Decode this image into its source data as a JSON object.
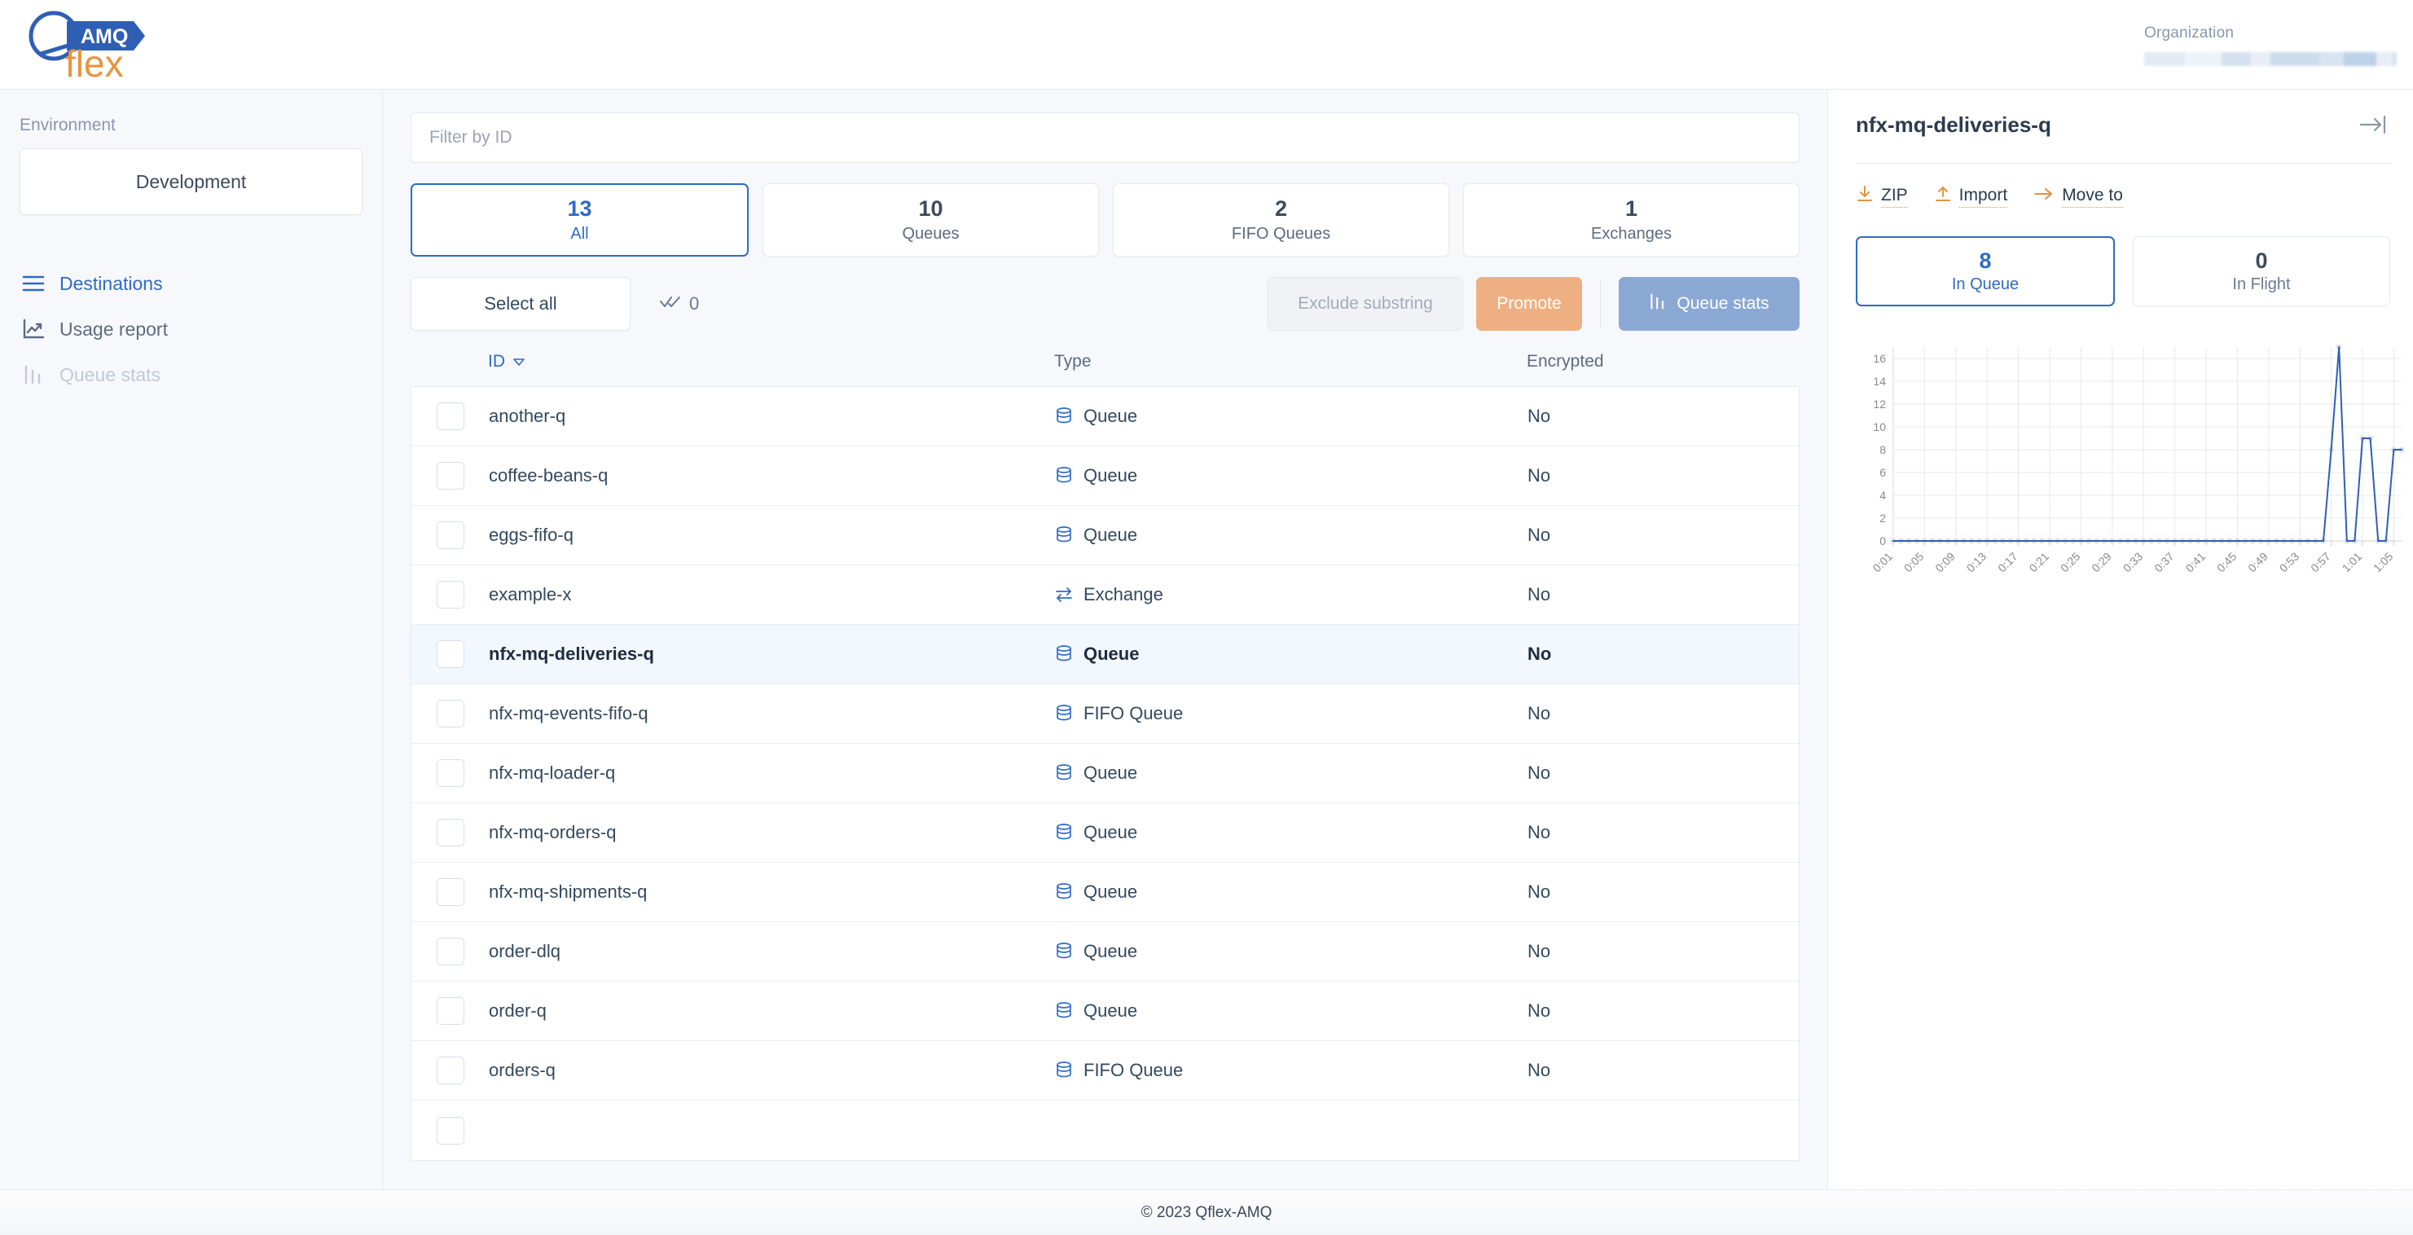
{
  "brand": {
    "name_top": "AMQ",
    "name_bottom": "flex"
  },
  "header": {
    "org_label": "Organization"
  },
  "sidebar": {
    "env_label": "Environment",
    "env_value": "Development",
    "items": [
      {
        "label": "Destinations",
        "icon": "menu-lines-icon",
        "state": "active"
      },
      {
        "label": "Usage report",
        "icon": "trend-chart-icon",
        "state": "normal"
      },
      {
        "label": "Queue stats",
        "icon": "bar-chart-icon",
        "state": "disabled"
      }
    ]
  },
  "main": {
    "filter_placeholder": "Filter by ID",
    "filter_value": "",
    "stat_cards": [
      {
        "num": "13",
        "label": "All",
        "selected": true
      },
      {
        "num": "10",
        "label": "Queues",
        "selected": false
      },
      {
        "num": "2",
        "label": "FIFO Queues",
        "selected": false
      },
      {
        "num": "1",
        "label": "Exchanges",
        "selected": false
      }
    ],
    "toolbar": {
      "select_all_label": "Select all",
      "selected_count": "0",
      "exclude_label": "Exclude substring",
      "promote_label": "Promote",
      "queue_stats_label": "Queue stats"
    },
    "table": {
      "columns": [
        "ID",
        "Type",
        "Encrypted"
      ],
      "sort_column": "ID",
      "sort_dir": "desc",
      "rows": [
        {
          "id": "another-q",
          "type": "Queue",
          "type_icon": "database-stack-icon",
          "encrypted": "No",
          "checked": false,
          "selected": false
        },
        {
          "id": "coffee-beans-q",
          "type": "Queue",
          "type_icon": "database-stack-icon",
          "encrypted": "No",
          "checked": false,
          "selected": false
        },
        {
          "id": "eggs-fifo-q",
          "type": "Queue",
          "type_icon": "database-stack-icon",
          "encrypted": "No",
          "checked": false,
          "selected": false
        },
        {
          "id": "example-x",
          "type": "Exchange",
          "type_icon": "swap-arrows-icon",
          "encrypted": "No",
          "checked": false,
          "selected": false
        },
        {
          "id": "nfx-mq-deliveries-q",
          "type": "Queue",
          "type_icon": "database-stack-icon",
          "encrypted": "No",
          "checked": false,
          "selected": true
        },
        {
          "id": "nfx-mq-events-fifo-q",
          "type": "FIFO Queue",
          "type_icon": "database-stack-icon",
          "encrypted": "No",
          "checked": false,
          "selected": false
        },
        {
          "id": "nfx-mq-loader-q",
          "type": "Queue",
          "type_icon": "database-stack-icon",
          "encrypted": "No",
          "checked": false,
          "selected": false
        },
        {
          "id": "nfx-mq-orders-q",
          "type": "Queue",
          "type_icon": "database-stack-icon",
          "encrypted": "No",
          "checked": false,
          "selected": false
        },
        {
          "id": "nfx-mq-shipments-q",
          "type": "Queue",
          "type_icon": "database-stack-icon",
          "encrypted": "No",
          "checked": false,
          "selected": false
        },
        {
          "id": "order-dlq",
          "type": "Queue",
          "type_icon": "database-stack-icon",
          "encrypted": "No",
          "checked": false,
          "selected": false
        },
        {
          "id": "order-q",
          "type": "Queue",
          "type_icon": "database-stack-icon",
          "encrypted": "No",
          "checked": false,
          "selected": false
        },
        {
          "id": "orders-q",
          "type": "FIFO Queue",
          "type_icon": "database-stack-icon",
          "encrypted": "No",
          "checked": false,
          "selected": false
        }
      ]
    }
  },
  "detail": {
    "title": "nfx-mq-deliveries-q",
    "collapse_icon": "collapse-right-icon",
    "actions": [
      {
        "label": "ZIP",
        "icon": "download-icon"
      },
      {
        "label": "Import",
        "icon": "upload-icon"
      },
      {
        "label": "Move to",
        "icon": "arrow-right-icon"
      }
    ],
    "counters": [
      {
        "num": "8",
        "label": "In Queue",
        "selected": true
      },
      {
        "num": "0",
        "label": "In Flight",
        "selected": false
      }
    ]
  },
  "chart_data": {
    "type": "line",
    "title": "",
    "xlabel": "",
    "ylabel": "",
    "ylim": [
      0,
      17
    ],
    "yticks": [
      0,
      2,
      4,
      6,
      8,
      10,
      12,
      14,
      16
    ],
    "grid": true,
    "legend": "none",
    "tick_labels": [
      "0:01",
      "0:05",
      "0:09",
      "0:13",
      "0:17",
      "0:21",
      "0:25",
      "0:29",
      "0:33",
      "0:37",
      "0:41",
      "0:45",
      "0:49",
      "0:53",
      "0:57",
      "1:01",
      "1:05"
    ],
    "series": [
      {
        "name": "In Queue",
        "color": "#2f5fb4",
        "values": [
          0,
          0,
          0,
          0,
          0,
          0,
          0,
          0,
          0,
          0,
          0,
          0,
          0,
          0,
          0,
          0,
          0,
          0,
          0,
          0,
          0,
          0,
          0,
          0,
          0,
          0,
          0,
          0,
          0,
          0,
          0,
          0,
          0,
          0,
          0,
          0,
          0,
          0,
          0,
          0,
          0,
          0,
          0,
          0,
          0,
          0,
          0,
          0,
          0,
          0,
          0,
          0,
          0,
          0,
          0,
          0,
          8,
          17,
          0,
          0,
          9,
          9,
          0,
          0,
          8,
          8
        ]
      }
    ],
    "x": [
      "0:01",
      "0:02",
      "0:03",
      "0:04",
      "0:05",
      "0:06",
      "0:07",
      "0:08",
      "0:09",
      "0:10",
      "0:11",
      "0:12",
      "0:13",
      "0:14",
      "0:15",
      "0:16",
      "0:17",
      "0:18",
      "0:19",
      "0:20",
      "0:21",
      "0:22",
      "0:23",
      "0:24",
      "0:25",
      "0:26",
      "0:27",
      "0:28",
      "0:29",
      "0:30",
      "0:31",
      "0:32",
      "0:33",
      "0:34",
      "0:35",
      "0:36",
      "0:37",
      "0:38",
      "0:39",
      "0:40",
      "0:41",
      "0:42",
      "0:43",
      "0:44",
      "0:45",
      "0:46",
      "0:47",
      "0:48",
      "0:49",
      "0:50",
      "0:51",
      "0:52",
      "0:53",
      "0:54",
      "0:55",
      "0:56",
      "0:57",
      "0:58",
      "0:59",
      "1:00",
      "1:01",
      "1:02",
      "1:03",
      "1:04",
      "1:05",
      "1:06"
    ]
  },
  "footer": {
    "copyright": "© 2023 Qflex-AMQ"
  },
  "colors": {
    "accent_blue": "#2f6bc4",
    "accent_orange": "#e2923f",
    "promote_bg": "#eeb082",
    "queue_stats_bg": "#8ba8d4",
    "page_bg": "#f7f8fc"
  }
}
